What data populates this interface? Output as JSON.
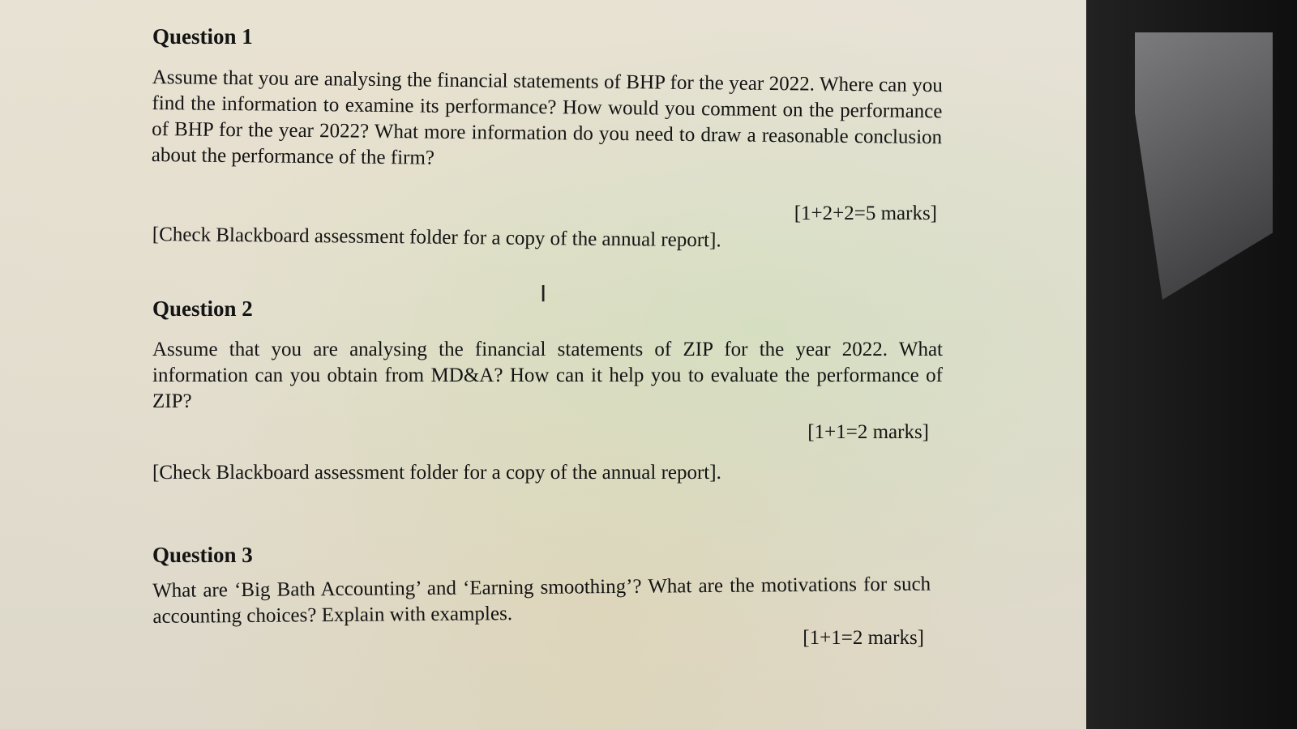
{
  "questions": [
    {
      "title": "Question 1",
      "body": "Assume that you are analysing the financial statements of BHP for the year 2022. Where can you find the information to examine its performance? How would you comment on the performance of BHP for the year 2022? What more information do you need to draw a reasonable conclusion about the performance of the firm?",
      "marks": "[1+2+2=5 marks]",
      "note": "[Check Blackboard assessment folder for a copy of the annual report]."
    },
    {
      "title": "Question 2",
      "body": "Assume that you are analysing the financial statements of ZIP for the year 2022. What information can you obtain from MD&A? How can it help you to evaluate the performance of ZIP?",
      "marks": "[1+1=2 marks]",
      "note": "[Check Blackboard assessment folder for a copy of the annual report]."
    },
    {
      "title": "Question 3",
      "body": "What are ‘Big Bath Accounting’ and ‘Earning smoothing’? What are the motivations for such accounting choices? Explain with examples.",
      "marks": "[1+1=2 marks]"
    }
  ],
  "cursor_icon": "text-cursor-icon"
}
